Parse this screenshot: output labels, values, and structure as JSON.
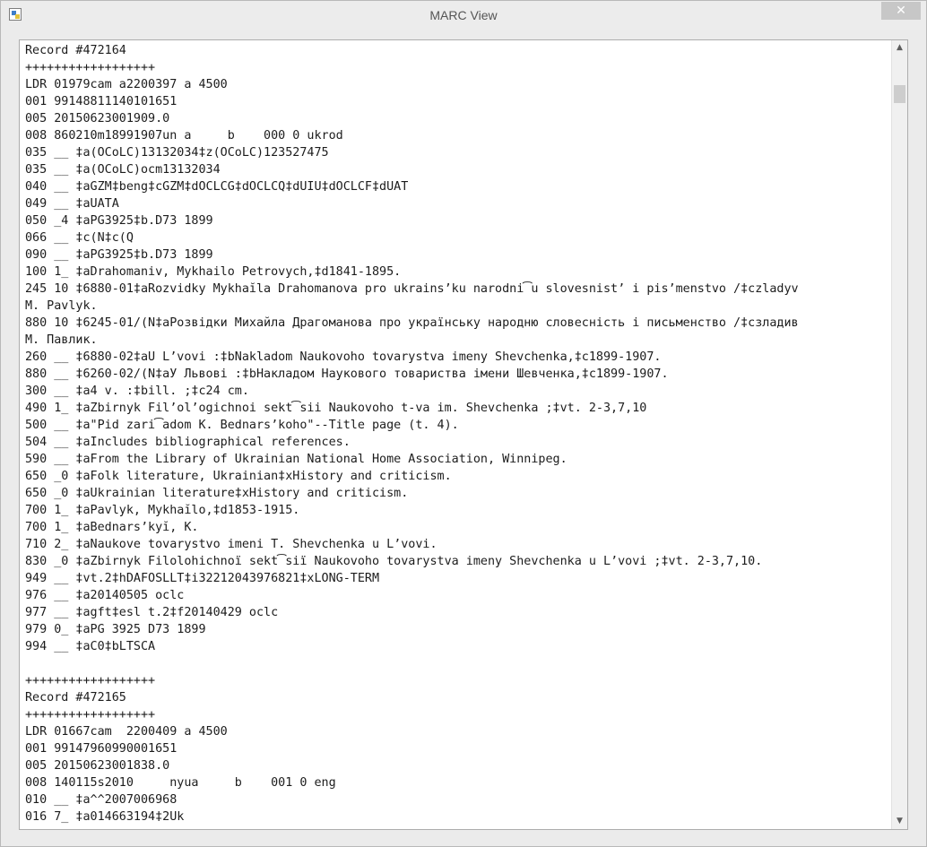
{
  "window": {
    "title": "MARC View",
    "close_icon": "close-icon",
    "app_icon": "window-app-icon"
  },
  "scrollbar": {
    "up_arrow": "▲",
    "down_arrow": "▼"
  },
  "lines": [
    "Record #472164",
    "++++++++++++++++++",
    "LDR 01979cam a2200397 a 4500",
    "001 99148811140101651",
    "005 20150623001909.0",
    "008 860210m18991907un a     b    000 0 ukrod",
    "035 __ ‡a(OCoLC)13132034‡z(OCoLC)123527475",
    "035 __ ‡a(OCoLC)ocm13132034",
    "040 __ ‡aGZM‡beng‡cGZM‡dOCLCG‡dOCLCQ‡dUIU‡dOCLCF‡dUAT",
    "049 __ ‡aUATA",
    "050 _4 ‡aPG3925‡b.D73 1899",
    "066 __ ‡c(N‡c(Q",
    "090 __ ‡aPG3925‡b.D73 1899",
    "100 1_ ‡aDrahomaniv, Mykhailo Petrovych,‡d1841-1895.",
    "245 10 ‡6880-01‡aRozvidky Mykhaĭla Drahomanova pro ukrains’ku narodni͡u slovesnist’ i pis’menstvo /‡czladyv",
    "M. Pavlyk.",
    "880 10 ‡6245-01/(N‡aРозвідки Михайла Драгоманова про українську народню словесність і письменство /‡сзладив",
    "М. Павлик.",
    "260 __ ‡6880-02‡aU L’vovi :‡bNakladom Naukovoho tovarystva imeny Shevchenka,‡c1899-1907.",
    "880 __ ‡6260-02/(N‡aУ Львові :‡bНакладом Наукового товариства імени Шевченка,‡c1899-1907.",
    "300 __ ‡a4 v. :‡bill. ;‡c24 cm.",
    "490 1_ ‡aZbirnyk Fil’ol’ogichnoi sekt͡sii Naukovoho t-va im. Shevchenka ;‡vt. 2-3,7,10",
    "500 __ ‡a\"Pid zari͡adom K. Bednars’koho\"--Title page (t. 4).",
    "504 __ ‡aIncludes bibliographical references.",
    "590 __ ‡aFrom the Library of Ukrainian National Home Association, Winnipeg.",
    "650 _0 ‡aFolk literature, Ukrainian‡xHistory and criticism.",
    "650 _0 ‡aUkrainian literature‡xHistory and criticism.",
    "700 1_ ‡aPavlyk, Mykhaĭlo,‡d1853-1915.",
    "700 1_ ‡aBednars’kyĭ, K.",
    "710 2_ ‡aNaukove tovarystvo imeni T. Shevchenka u L’vovi.",
    "830 _0 ‡aZbirnyk Filolohichnoï sekt͡siï Naukovoho tovarystva imeny Shevchenka u L’vovi ;‡vt. 2-3,7,10.",
    "949 __ ‡vt.2‡hDAFOSLLT‡i32212043976821‡xLONG-TERM",
    "976 __ ‡a20140505 oclc",
    "977 __ ‡agft‡esl t.2‡f20140429 oclc",
    "979 0_ ‡aPG 3925 D73 1899",
    "994 __ ‡aC0‡bLTSCA",
    "",
    "++++++++++++++++++",
    "Record #472165",
    "++++++++++++++++++",
    "LDR 01667cam  2200409 a 4500",
    "001 99147960990001651",
    "005 20150623001838.0",
    "008 140115s2010     nyua     b    001 0 eng",
    "010 __ ‡a^^2007006968",
    "016 7_ ‡a014663194‡2Uk"
  ]
}
